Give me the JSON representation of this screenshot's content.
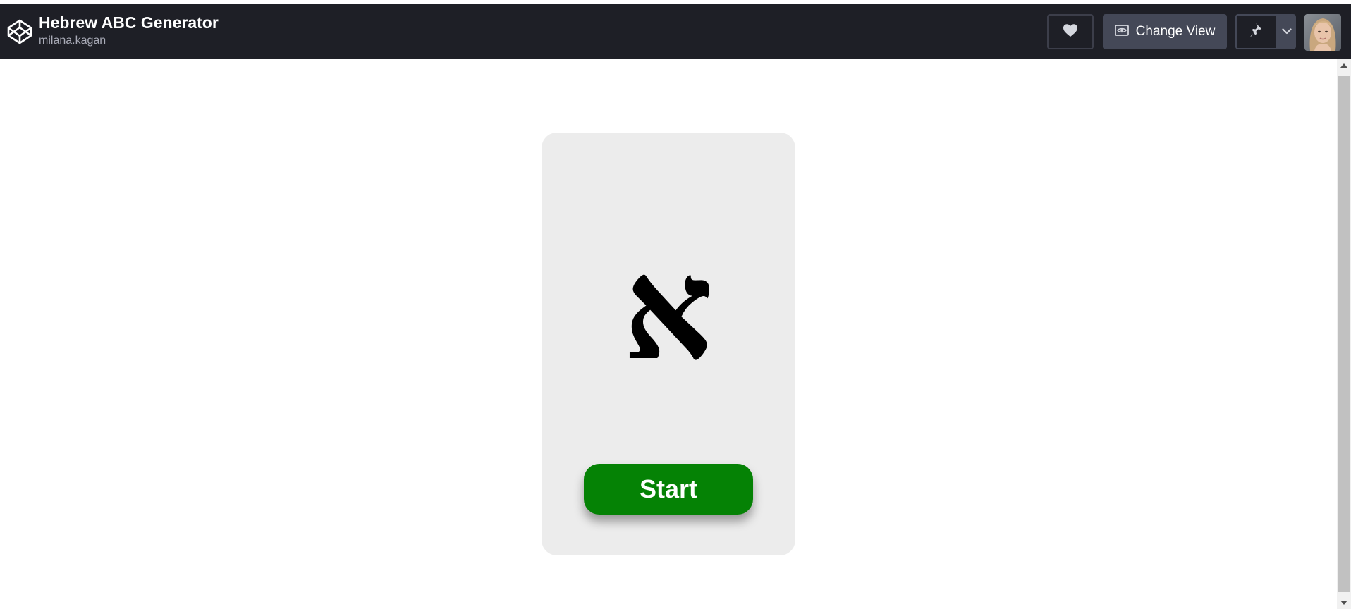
{
  "header": {
    "title": "Hebrew ABC Generator",
    "owner": "milana.kagan",
    "change_view_label": "Change View",
    "background": "#1e1f26"
  },
  "icons": {
    "logo": "codepen-logo-icon",
    "heart": "heart-icon",
    "view": "eye-icon",
    "pin": "pin-icon",
    "caret": "chevron-down-icon"
  },
  "card": {
    "letter": "א",
    "start_label": "Start",
    "accent": "#058205",
    "background": "#ececec"
  }
}
